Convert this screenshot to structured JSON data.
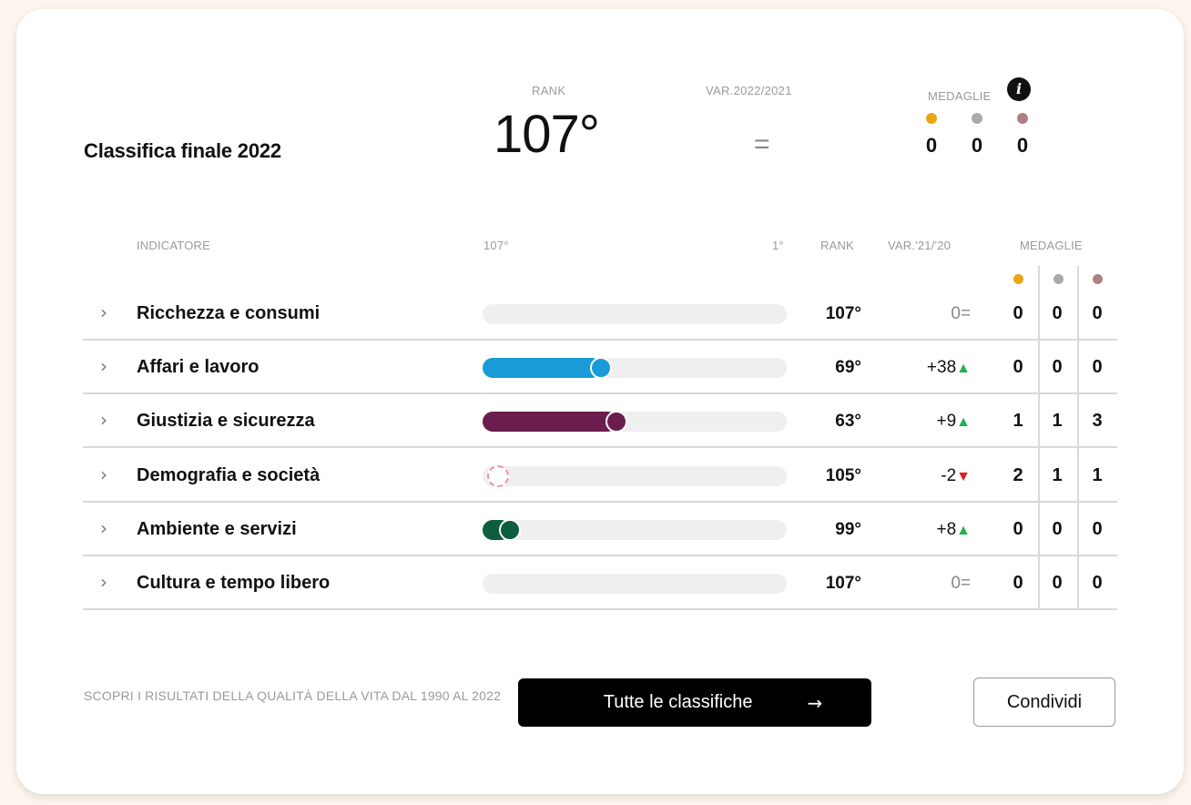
{
  "header": {
    "title": "Classifica finale 2022",
    "rank_label": "RANK",
    "rank_value": "107°",
    "var_label": "VAR.2022/2021",
    "var_value": "=",
    "medals_label": "MEDAGLIE",
    "info_icon": "i",
    "medals": [
      "0",
      "0",
      "0"
    ]
  },
  "colors": {
    "gold": "#e8a615",
    "silver": "#aaaaaa",
    "bronze": "#b08080",
    "up": "#22b14c",
    "down": "#e01e1e"
  },
  "table": {
    "columns": {
      "indicator": "INDICATORE",
      "scale_min": "107°",
      "scale_max": "1°",
      "rank": "RANK",
      "var": "VAR.'21/'20",
      "medals": "MEDAGLIE"
    },
    "rows": [
      {
        "name": "Ricchezza e consumi",
        "rank": "107°",
        "var_num": "0",
        "var_sym": "=",
        "bar_color": "",
        "bar_fraction": 0.0,
        "medals": [
          "0",
          "0",
          "0"
        ]
      },
      {
        "name": "Affari e lavoro",
        "rank": "69°",
        "var_num": "+38",
        "var_sym": "▲",
        "bar_color": "#1a9bd7",
        "bar_fraction": 0.36,
        "medals": [
          "0",
          "0",
          "0"
        ]
      },
      {
        "name": "Giustizia e sicurezza",
        "rank": "63°",
        "var_num": "+9",
        "var_sym": "▲",
        "bar_color": "#6b1d4f",
        "bar_fraction": 0.41,
        "medals": [
          "1",
          "1",
          "3"
        ]
      },
      {
        "name": "Demografia e società",
        "rank": "105°",
        "var_num": "-2",
        "var_sym": "▼",
        "bar_color": "#f28fb0",
        "bar_fraction": 0.02,
        "medals": [
          "2",
          "1",
          "1"
        ]
      },
      {
        "name": "Ambiente e servizi",
        "rank": "99°",
        "var_num": "+8",
        "var_sym": "▲",
        "bar_color": "#0c5e3e",
        "bar_fraction": 0.06,
        "medals": [
          "0",
          "0",
          "0"
        ]
      },
      {
        "name": "Cultura e tempo libero",
        "rank": "107°",
        "var_num": "0",
        "var_sym": "=",
        "bar_color": "",
        "bar_fraction": 0.0,
        "medals": [
          "0",
          "0",
          "0"
        ]
      }
    ]
  },
  "footer": {
    "text": "SCOPRI I RISULTATI DELLA QUALITÀ DELLA VITA DAL 1990 AL 2022",
    "primary_button": "Tutte le classifiche",
    "primary_arrow": "→",
    "secondary_button": "Condividi"
  }
}
